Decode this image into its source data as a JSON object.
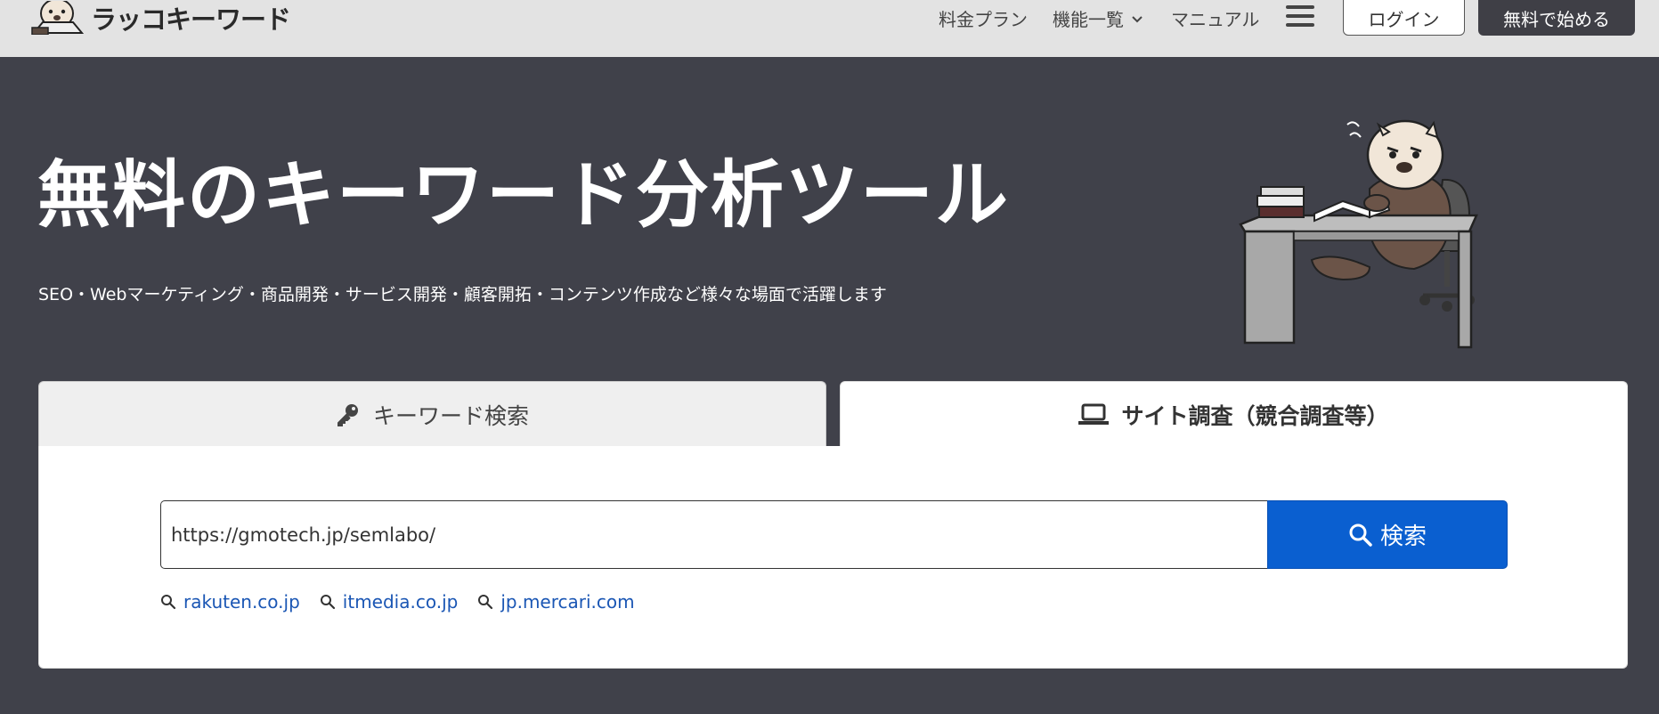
{
  "header": {
    "logo_text": "ラッコキーワード",
    "nav": {
      "plan": "料金プラン",
      "features": "機能一覧",
      "manual": "マニュアル"
    },
    "login": "ログイン",
    "start": "無料で始める"
  },
  "hero": {
    "title": "無料のキーワード分析ツール",
    "subtitle": "SEO・Webマーケティング・商品開発・サービス開発・顧客開拓・コンテンツ作成など様々な場面で活躍します"
  },
  "tabs": [
    {
      "label": "キーワード検索",
      "icon": "key-icon",
      "active": false
    },
    {
      "label": "サイト調査（競合調査等）",
      "icon": "laptop-icon",
      "active": true
    }
  ],
  "search": {
    "value": "https://gmotech.jp/semlabo/",
    "button_label": "検索"
  },
  "suggestions": [
    "rakuten.co.jp",
    "itmedia.co.jp",
    "jp.mercari.com"
  ],
  "colors": {
    "header_bg": "#e3e3e3",
    "hero_bg": "#40414a",
    "primary": "#0a5fd0",
    "link": "#1a56b4"
  }
}
